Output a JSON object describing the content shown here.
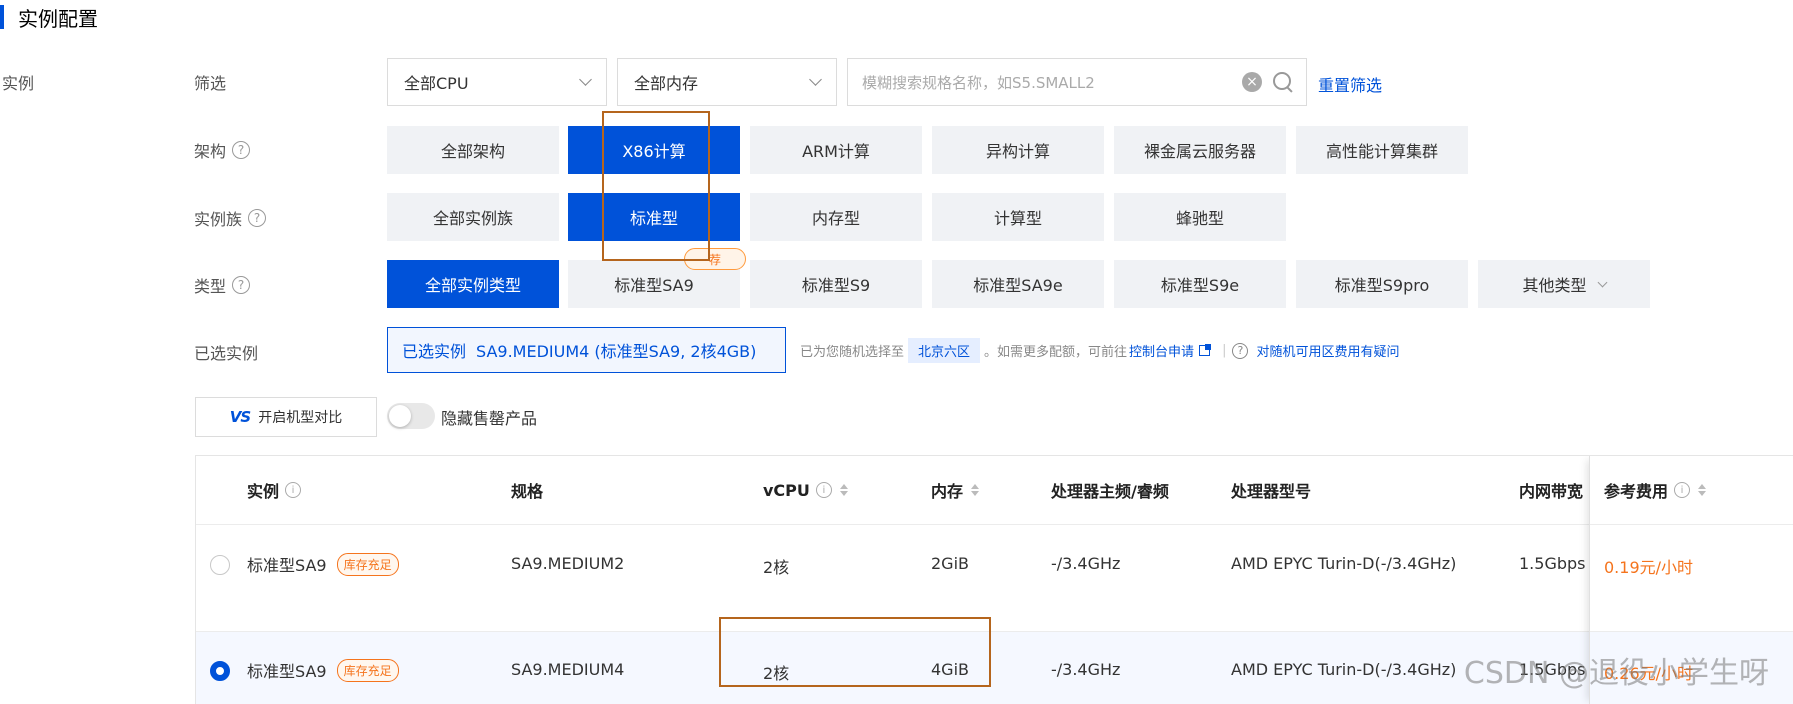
{
  "section": {
    "title": "实例配置"
  },
  "side_label": "实例",
  "filter": {
    "label": "筛选",
    "cpu_select": "全部CPU",
    "memory_select": "全部内存",
    "search_placeholder": "模糊搜索规格名称，如S5.SMALL2",
    "reset_label": "重置筛选"
  },
  "architecture": {
    "label": "架构",
    "options": [
      "全部架构",
      "X86计算",
      "ARM计算",
      "异构计算",
      "裸金属云服务器",
      "高性能计算集群"
    ],
    "selected": "X86计算"
  },
  "family": {
    "label": "实例族",
    "options": [
      "全部实例族",
      "标准型",
      "内存型",
      "计算型",
      "蜂驰型"
    ],
    "selected": "标准型"
  },
  "type": {
    "label": "类型",
    "options": [
      "全部实例类型",
      "标准型SA9",
      "标准型S9",
      "标准型SA9e",
      "标准型S9e",
      "标准型S9pro",
      "其他类型"
    ],
    "selected": "全部实例类型",
    "recommend_badge": "荐"
  },
  "selected_instance": {
    "label": "已选实例",
    "prefix": "已选实例",
    "value": "SA9.MEDIUM4 (标准型SA9, 2核4GB)",
    "zone_prefix": "已为您随机选择至",
    "zone": "北京六区",
    "zone_suffix": "。如需更多配额，可前往",
    "console_link": "控制台申请",
    "question": "对随机可用区费用有疑问"
  },
  "toolbar": {
    "compare_icon": "VS",
    "compare_label": "开启机型对比",
    "hide_soldout_label": "隐藏售罄产品",
    "hide_soldout_on": false
  },
  "table": {
    "headers": {
      "instance": "实例",
      "spec": "规格",
      "vcpu": "vCPU",
      "memory": "内存",
      "freq": "处理器主频/睿频",
      "model": "处理器型号",
      "bandwidth": "内网带宽",
      "price": "参考费用"
    },
    "rows": [
      {
        "selected": false,
        "instance": "标准型SA9",
        "stock": "库存充足",
        "spec": "SA9.MEDIUM2",
        "vcpu": "2核",
        "memory": "2GiB",
        "freq": "-/3.4GHz",
        "model": "AMD EPYC Turin-D(-/3.4GHz)",
        "bandwidth": "1.5Gbps",
        "price": "0.19元/小时"
      },
      {
        "selected": true,
        "instance": "标准型SA9",
        "stock": "库存充足",
        "spec": "SA9.MEDIUM4",
        "vcpu": "2核",
        "memory": "4GiB",
        "freq": "-/3.4GHz",
        "model": "AMD EPYC Turin-D(-/3.4GHz)",
        "bandwidth": "1.5Gbps",
        "price": "0.26元/小时"
      }
    ]
  },
  "watermark": "CSDN @退役小学生呀",
  "colors": {
    "primary": "#0052d9",
    "price": "#f5741d",
    "annotation": "#b5651d"
  }
}
